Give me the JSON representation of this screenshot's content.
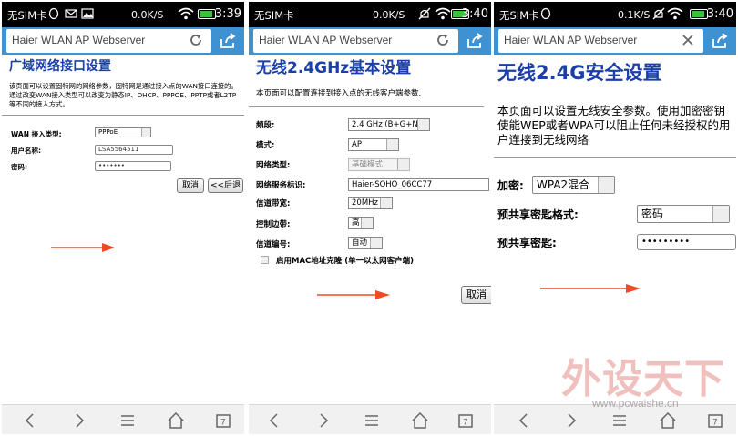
{
  "phones": [
    {
      "status": {
        "carrier": "无SIM卡",
        "speed": "0.0K/S",
        "time": "3:39"
      },
      "url": "Haier WLAN AP Webserver",
      "page": {
        "title": "广域网络接口设置",
        "description": "该页面可以设置固特网的网络参数，固特网是通过接入点的WAN接口连接的。通过改变WAN接入类型可以改变为静态IP、DHCP、PPPOE、PPTP或者L2TP等不同的接入方式。",
        "wan_type_label": "WAN 接入类型:",
        "wan_type_value": "PPPoE",
        "username_label": "用户名称:",
        "username_value": "LSA5564511",
        "password_label": "密码:",
        "password_value": "•••••••",
        "cancel_label": "取消",
        "back_label": "<<后退"
      }
    },
    {
      "status": {
        "carrier": "无SIM卡",
        "speed": "0.0K/S",
        "time": "3:40"
      },
      "url": "Haier WLAN AP Webserver",
      "page": {
        "title": "无线2.4GHz基本设置",
        "description": "本页面可以配置连接到接入点的无线客户端参数.",
        "fields": [
          {
            "label": "频段:",
            "value": "2.4 GHz (B+G+N)"
          },
          {
            "label": "模式:",
            "value": "AP"
          },
          {
            "label": "网络类型:",
            "value": "基础模式"
          },
          {
            "label": "网络服务标识:",
            "value": "Haier-SOHO_06CC77"
          },
          {
            "label": "信道带宽:",
            "value": "20MHz"
          },
          {
            "label": "控制边带:",
            "value": "高"
          },
          {
            "label": "信道编号:",
            "value": "自动"
          }
        ],
        "mac_clone_label": "启用MAC地址克隆 (单一以太网客户端)",
        "cancel_label": "取消"
      }
    },
    {
      "status": {
        "carrier": "无SIM卡",
        "speed": "0.1K/S",
        "time": "3:40"
      },
      "url": "Haier WLAN AP Webserver",
      "page": {
        "title": "无线2.4G安全设置",
        "description": "本页面可以设置无线安全参数。使用加密密钥使能WEP或者WPA可以阻止任何未经授权的用户连接到无线网络",
        "encryption_label": "加密:",
        "encryption_value": "WPA2混合",
        "psk_format_label": "预共享密匙格式:",
        "psk_format_value": "密码",
        "psk_label": "预共享密匙:",
        "psk_value": "•••••••••"
      }
    }
  ],
  "watermark": {
    "text": "外设天下",
    "url": "www.pcwaishe.cn"
  },
  "colors": {
    "url_bar": "#3f92d2",
    "title": "#1a3fa8",
    "arrow": "#ef4a23",
    "status_bar": "#000000"
  }
}
